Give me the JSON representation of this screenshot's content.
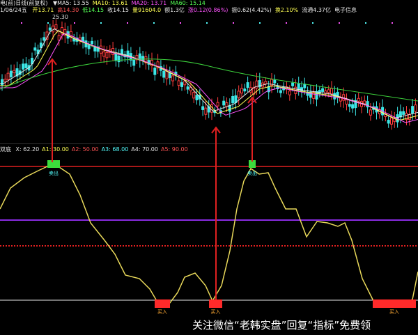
{
  "price_panel": {
    "title": "电(前)日线(前复权)",
    "date": "1/06/24五",
    "ma_labels": [
      {
        "text": "▼MA5: 13.55",
        "color": "#e6e6e6"
      },
      {
        "text": "MA10: 13.61",
        "color": "#ffff54"
      },
      {
        "text": "MA20: 13.71",
        "color": "#ff54ff"
      },
      {
        "text": "MA60: 15.14",
        "color": "#54ff54"
      }
    ],
    "quote_line": [
      {
        "text": "开13.71",
        "color": "#ffff54"
      },
      {
        "text": "高14.30",
        "color": "#ff5454"
      },
      {
        "text": "低14.15",
        "color": "#54ff54"
      },
      {
        "text": "收14.15",
        "color": "#e6e6e6"
      },
      {
        "text": "量91604.0",
        "color": "#ffff54"
      },
      {
        "text": "额1.3亿",
        "color": "#e6e6e6"
      },
      {
        "text": "涨0.12(0.86%)",
        "color": "#ff54ff"
      },
      {
        "text": "振0.62(4.42%)",
        "color": "#e6e6e6"
      },
      {
        "text": "换2.10%",
        "color": "#ffff54"
      },
      {
        "text": "流通4.37亿",
        "color": "#e6e6e6"
      },
      {
        "text": "电子信息",
        "color": "#e6e6e6"
      }
    ],
    "price_marker": "25.30"
  },
  "indicator_panel": {
    "name": "双底",
    "params": [
      {
        "text": "X: 62.20",
        "color": "#e6e6e6"
      },
      {
        "text": "A1: 30.00",
        "color": "#ffff54"
      },
      {
        "text": "A2: 50.00",
        "color": "#ff5454"
      },
      {
        "text": "A3: 68.00",
        "color": "#54ffff"
      },
      {
        "text": "A4: 70.00",
        "color": "#e6e6e6"
      },
      {
        "text": "A5: 90.00",
        "color": "#ff5454"
      }
    ],
    "sell_labels": [
      "卖出",
      "卖出"
    ],
    "buy_labels": [
      "买入",
      "买入",
      "买入"
    ],
    "line_colors": {
      "curve": "#e8d85a",
      "level_high": "#e02020",
      "level_mid": "#8a2be2",
      "level_low": "#e02020",
      "level_zero": "#e6e6e6",
      "arrow": "#e02020"
    }
  },
  "watermark": "关注微信“老韩实盘”回复“指标”免费领"
}
